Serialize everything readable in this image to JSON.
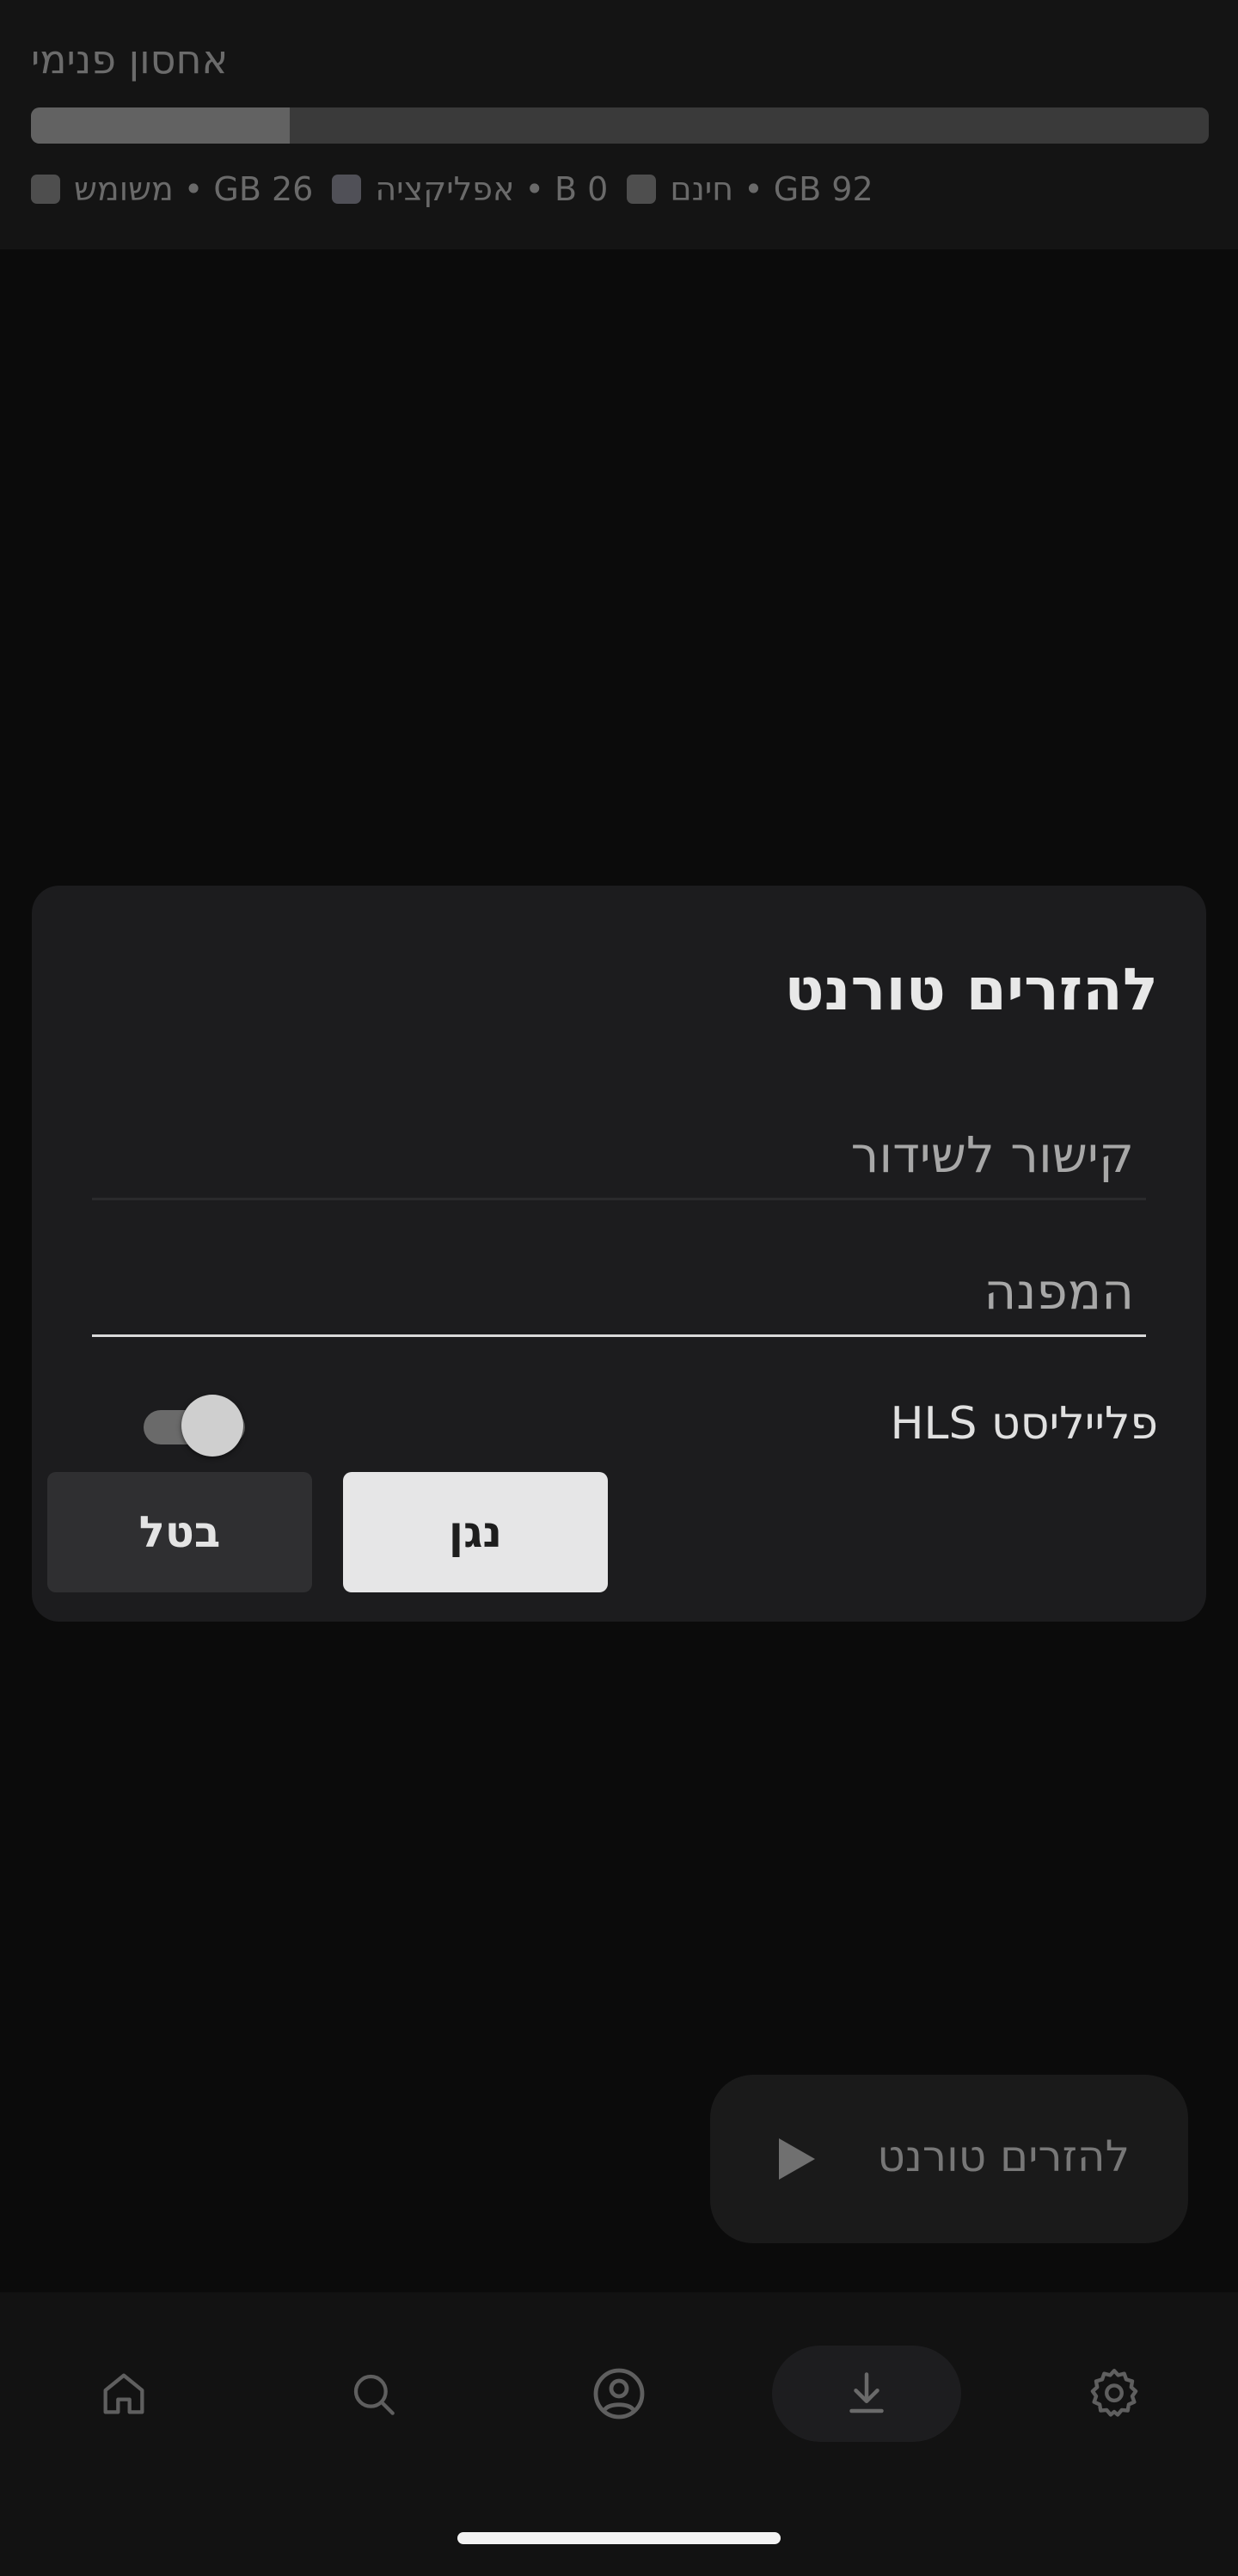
{
  "storage": {
    "title": "אחסון פנימי",
    "used_fraction": 0.22,
    "legend": {
      "free": "92 GB • חינם",
      "app": "0 B • אפליקציה",
      "used": "26 GB • משומש"
    }
  },
  "dialog": {
    "title": "להזרים טורנט",
    "link_placeholder": "קישור לשידור",
    "folder_placeholder": "המפנה",
    "hls_label": "פלייליסט HLS",
    "hls_enabled": true,
    "play_label": "נגן",
    "cancel_label": "בטל"
  },
  "fab": {
    "label": "להזרים טורנט",
    "icon": "play-icon"
  },
  "nav": {
    "items": [
      {
        "icon": "home-icon"
      },
      {
        "icon": "search-icon"
      },
      {
        "icon": "profile-icon"
      },
      {
        "icon": "download-icon",
        "active": true
      },
      {
        "icon": "settings-gear-icon"
      }
    ]
  },
  "colors": {
    "background": "#0b0b0b",
    "dialog": "#1c1c1e",
    "accent_button": "#e6e6e7"
  }
}
